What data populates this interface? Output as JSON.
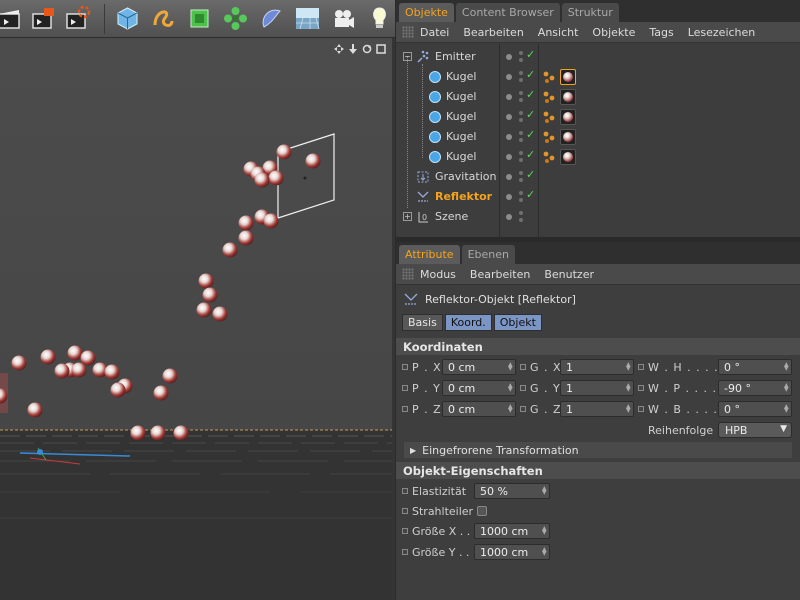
{
  "colors": {
    "accent": "#f4a31f",
    "check": "#5fd35f",
    "tab_active": "#7b95c5"
  },
  "toolbar": {
    "icons": [
      "clapper-board-icon",
      "render-view-icon",
      "render-settings-icon",
      "cube-icon",
      "spline-icon",
      "nurbs-icon",
      "array-icon",
      "deformer-icon",
      "floor-icon",
      "camera-icon",
      "light-icon"
    ]
  },
  "viewport": {
    "nav_icons": [
      "move-view-icon",
      "zoom-view-icon",
      "rotate-view-icon",
      "maximize-view-icon"
    ]
  },
  "top_tabs": [
    {
      "label": "Objekte",
      "active": true
    },
    {
      "label": "Content Browser",
      "active": false
    },
    {
      "label": "Struktur",
      "active": false
    }
  ],
  "object_menu": [
    "Datei",
    "Bearbeiten",
    "Ansicht",
    "Objekte",
    "Tags",
    "Lesezeichen"
  ],
  "objects": [
    {
      "name": "Emitter",
      "selected": false
    },
    {
      "name": "Kugel",
      "selected": false
    },
    {
      "name": "Kugel",
      "selected": false
    },
    {
      "name": "Kugel",
      "selected": false
    },
    {
      "name": "Kugel",
      "selected": false
    },
    {
      "name": "Kugel",
      "selected": false
    },
    {
      "name": "Gravitation",
      "selected": false
    },
    {
      "name": "Reflektor",
      "selected": true
    },
    {
      "name": "Szene",
      "selected": false
    }
  ],
  "attr_tabs": [
    {
      "label": "Attribute",
      "active": true
    },
    {
      "label": "Ebenen",
      "active": false
    }
  ],
  "attr_menu": [
    "Modus",
    "Bearbeiten",
    "Benutzer"
  ],
  "attr": {
    "title": "Reflektor-Objekt [Reflektor]",
    "tabs": [
      {
        "label": "Basis",
        "active": false
      },
      {
        "label": "Koord.",
        "active": true
      },
      {
        "label": "Objekt",
        "active": true
      }
    ],
    "coord_head": "Koordinaten",
    "coords": [
      {
        "p_label": "P . X",
        "p_val": "0 cm",
        "g_label": "G . X",
        "g_val": "1",
        "w_label": "W . H . . . . . .",
        "w_val": "0 °"
      },
      {
        "p_label": "P . Y",
        "p_val": "0 cm",
        "g_label": "G . Y",
        "g_val": "1",
        "w_label": "W . P . . . . . .",
        "w_val": "-90 °"
      },
      {
        "p_label": "P . Z",
        "p_val": "0 cm",
        "g_label": "G . Z",
        "g_val": "1",
        "w_label": "W . B . . . . . .",
        "w_val": "0 °"
      }
    ],
    "order_label": "Reihenfolge",
    "order_value": "HPB",
    "frozen_head": "Eingefrorene Transformation",
    "props_head": "Objekt-Eigenschaften",
    "elasticity_label": "Elastizität",
    "elasticity_value": "50 %",
    "splitter_label": "Strahlteiler",
    "size_x_label": "Größe X . .",
    "size_x_value": "1000 cm",
    "size_y_label": "Größe Y . .",
    "size_y_value": "1000 cm"
  }
}
